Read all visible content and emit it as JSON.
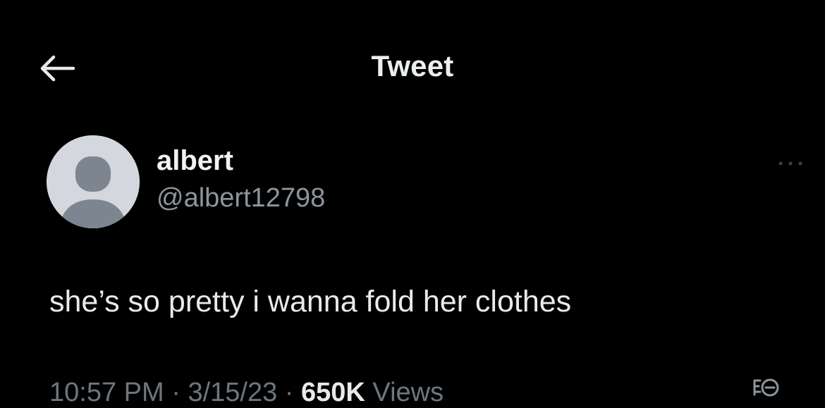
{
  "header": {
    "title": "Tweet",
    "back_icon": "arrow-left-icon"
  },
  "author": {
    "display_name": "albert",
    "handle": "@albert12798",
    "avatar_icon": "default-avatar-icon",
    "more_icon": "more-horizontal-icon"
  },
  "tweet": {
    "text": "she’s so pretty i wanna fold her clothes"
  },
  "meta": {
    "time": "10:57 PM",
    "separator": "·",
    "date": "3/15/23",
    "views_count": "650K",
    "views_label": "Views",
    "analytics_icon": "analytics-icon"
  },
  "colors": {
    "background": "#000000",
    "primary_text": "#e7e9ea",
    "secondary_text": "#6e767d",
    "avatar_bg": "#d4d7dd",
    "avatar_figure": "#7c8590"
  }
}
